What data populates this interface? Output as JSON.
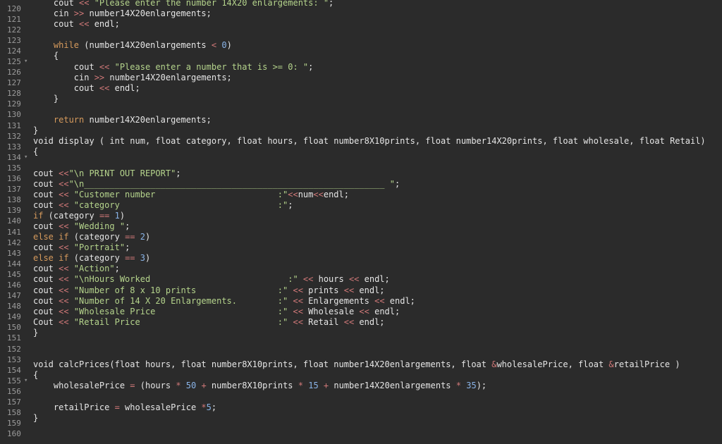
{
  "editor": {
    "lines": [
      {
        "n": "120",
        "fold": "",
        "tokens": [
          {
            "t": "    cout ",
            "c": "txt"
          },
          {
            "t": "<<",
            "c": "op"
          },
          {
            "t": " \"Please enter the number 14X20 enlargements: \"",
            "c": "str"
          },
          {
            "t": ";",
            "c": "txt"
          }
        ]
      },
      {
        "n": "121",
        "fold": "",
        "tokens": [
          {
            "t": "    cin ",
            "c": "txt"
          },
          {
            "t": ">>",
            "c": "op"
          },
          {
            "t": " number14X20enlargements;",
            "c": "txt"
          }
        ]
      },
      {
        "n": "122",
        "fold": "",
        "tokens": [
          {
            "t": "    cout ",
            "c": "txt"
          },
          {
            "t": "<<",
            "c": "op"
          },
          {
            "t": " endl;",
            "c": "txt"
          }
        ]
      },
      {
        "n": "123",
        "fold": "",
        "tokens": []
      },
      {
        "n": "124",
        "fold": "",
        "tokens": [
          {
            "t": "    while",
            "c": "kw"
          },
          {
            "t": " (number14X20enlargements ",
            "c": "txt"
          },
          {
            "t": "<",
            "c": "op"
          },
          {
            "t": " ",
            "c": "txt"
          },
          {
            "t": "0",
            "c": "num"
          },
          {
            "t": ")",
            "c": "txt"
          }
        ]
      },
      {
        "n": "125",
        "fold": "▾",
        "tokens": [
          {
            "t": "    {",
            "c": "txt"
          }
        ]
      },
      {
        "n": "126",
        "fold": "",
        "tokens": [
          {
            "t": "        cout ",
            "c": "txt"
          },
          {
            "t": "<<",
            "c": "op"
          },
          {
            "t": " \"Please enter a number that is >= 0: \"",
            "c": "str"
          },
          {
            "t": ";",
            "c": "txt"
          }
        ]
      },
      {
        "n": "127",
        "fold": "",
        "tokens": [
          {
            "t": "        cin ",
            "c": "txt"
          },
          {
            "t": ">>",
            "c": "op"
          },
          {
            "t": " number14X20enlargements;",
            "c": "txt"
          }
        ]
      },
      {
        "n": "128",
        "fold": "",
        "tokens": [
          {
            "t": "        cout ",
            "c": "txt"
          },
          {
            "t": "<<",
            "c": "op"
          },
          {
            "t": " endl;",
            "c": "txt"
          }
        ]
      },
      {
        "n": "129",
        "fold": "",
        "tokens": [
          {
            "t": "    }",
            "c": "txt"
          }
        ]
      },
      {
        "n": "130",
        "fold": "",
        "tokens": []
      },
      {
        "n": "131",
        "fold": "",
        "tokens": [
          {
            "t": "    return",
            "c": "kw"
          },
          {
            "t": " number14X20enlargements;",
            "c": "txt"
          }
        ]
      },
      {
        "n": "132",
        "fold": "",
        "tokens": [
          {
            "t": "}",
            "c": "txt"
          }
        ]
      },
      {
        "n": "133",
        "fold": "",
        "tokens": [
          {
            "t": "void display ( int num, float category, float hours, float number8X10prints, float number14X20prints, float wholesale, float Retail)",
            "c": "txt"
          }
        ]
      },
      {
        "n": "134",
        "fold": "▾",
        "tokens": [
          {
            "t": "{",
            "c": "txt"
          }
        ]
      },
      {
        "n": "135",
        "fold": "",
        "tokens": []
      },
      {
        "n": "136",
        "fold": "",
        "tokens": [
          {
            "t": "cout ",
            "c": "txt"
          },
          {
            "t": "<<",
            "c": "op"
          },
          {
            "t": "\"\\n PRINT OUT REPORT\"",
            "c": "str"
          },
          {
            "t": ";",
            "c": "txt"
          }
        ]
      },
      {
        "n": "137",
        "fold": "",
        "tokens": [
          {
            "t": "cout ",
            "c": "txt"
          },
          {
            "t": "<<",
            "c": "op"
          },
          {
            "t": "\"\\n___________________________________________________________ \"",
            "c": "str"
          },
          {
            "t": ";",
            "c": "txt"
          }
        ]
      },
      {
        "n": "138",
        "fold": "",
        "tokens": [
          {
            "t": "cout ",
            "c": "txt"
          },
          {
            "t": "<<",
            "c": "op"
          },
          {
            "t": " \"Customer number                        :\"",
            "c": "str"
          },
          {
            "t": "<<",
            "c": "op"
          },
          {
            "t": "num",
            "c": "txt"
          },
          {
            "t": "<<",
            "c": "op"
          },
          {
            "t": "endl;",
            "c": "txt"
          }
        ]
      },
      {
        "n": "139",
        "fold": "",
        "tokens": [
          {
            "t": "cout ",
            "c": "txt"
          },
          {
            "t": "<<",
            "c": "op"
          },
          {
            "t": " \"category                               :\"",
            "c": "str"
          },
          {
            "t": ";",
            "c": "txt"
          }
        ]
      },
      {
        "n": "140",
        "fold": "",
        "tokens": [
          {
            "t": "if",
            "c": "kw"
          },
          {
            "t": " (category ",
            "c": "txt"
          },
          {
            "t": "==",
            "c": "op"
          },
          {
            "t": " ",
            "c": "txt"
          },
          {
            "t": "1",
            "c": "num"
          },
          {
            "t": ")",
            "c": "txt"
          }
        ]
      },
      {
        "n": "141",
        "fold": "",
        "tokens": [
          {
            "t": "cout ",
            "c": "txt"
          },
          {
            "t": "<<",
            "c": "op"
          },
          {
            "t": " \"Wedding \"",
            "c": "str"
          },
          {
            "t": ";",
            "c": "txt"
          }
        ]
      },
      {
        "n": "142",
        "fold": "",
        "tokens": [
          {
            "t": "else if",
            "c": "kw"
          },
          {
            "t": " (category ",
            "c": "txt"
          },
          {
            "t": "==",
            "c": "op"
          },
          {
            "t": " ",
            "c": "txt"
          },
          {
            "t": "2",
            "c": "num"
          },
          {
            "t": ")",
            "c": "txt"
          }
        ]
      },
      {
        "n": "143",
        "fold": "",
        "tokens": [
          {
            "t": "cout ",
            "c": "txt"
          },
          {
            "t": "<<",
            "c": "op"
          },
          {
            "t": " \"Portrait\"",
            "c": "str"
          },
          {
            "t": ";",
            "c": "txt"
          }
        ]
      },
      {
        "n": "144",
        "fold": "",
        "tokens": [
          {
            "t": "else if",
            "c": "kw"
          },
          {
            "t": " (category ",
            "c": "txt"
          },
          {
            "t": "==",
            "c": "op"
          },
          {
            "t": " ",
            "c": "txt"
          },
          {
            "t": "3",
            "c": "num"
          },
          {
            "t": ")",
            "c": "txt"
          }
        ]
      },
      {
        "n": "145",
        "fold": "",
        "tokens": [
          {
            "t": "cout ",
            "c": "txt"
          },
          {
            "t": "<<",
            "c": "op"
          },
          {
            "t": " \"Action\"",
            "c": "str"
          },
          {
            "t": ";",
            "c": "txt"
          }
        ]
      },
      {
        "n": "146",
        "fold": "",
        "tokens": [
          {
            "t": "cout ",
            "c": "txt"
          },
          {
            "t": "<<",
            "c": "op"
          },
          {
            "t": " \"\\nHours Worked                           :\"",
            "c": "str"
          },
          {
            "t": " ",
            "c": "txt"
          },
          {
            "t": "<<",
            "c": "op"
          },
          {
            "t": " hours ",
            "c": "txt"
          },
          {
            "t": "<<",
            "c": "op"
          },
          {
            "t": " endl;",
            "c": "txt"
          }
        ]
      },
      {
        "n": "147",
        "fold": "",
        "tokens": [
          {
            "t": "cout ",
            "c": "txt"
          },
          {
            "t": "<<",
            "c": "op"
          },
          {
            "t": " \"Number of 8 x 10 prints                :\"",
            "c": "str"
          },
          {
            "t": " ",
            "c": "txt"
          },
          {
            "t": "<<",
            "c": "op"
          },
          {
            "t": " prints ",
            "c": "txt"
          },
          {
            "t": "<<",
            "c": "op"
          },
          {
            "t": " endl;",
            "c": "txt"
          }
        ]
      },
      {
        "n": "148",
        "fold": "",
        "tokens": [
          {
            "t": "cout ",
            "c": "txt"
          },
          {
            "t": "<<",
            "c": "op"
          },
          {
            "t": " \"Number of 14 X 20 Enlargements.        :\"",
            "c": "str"
          },
          {
            "t": " ",
            "c": "txt"
          },
          {
            "t": "<<",
            "c": "op"
          },
          {
            "t": " Enlargements ",
            "c": "txt"
          },
          {
            "t": "<<",
            "c": "op"
          },
          {
            "t": " endl;",
            "c": "txt"
          }
        ]
      },
      {
        "n": "149",
        "fold": "",
        "tokens": [
          {
            "t": "cout ",
            "c": "txt"
          },
          {
            "t": "<<",
            "c": "op"
          },
          {
            "t": " \"Wholesale Price                        :\"",
            "c": "str"
          },
          {
            "t": " ",
            "c": "txt"
          },
          {
            "t": "<<",
            "c": "op"
          },
          {
            "t": " Wholesale ",
            "c": "txt"
          },
          {
            "t": "<<",
            "c": "op"
          },
          {
            "t": " endl;",
            "c": "txt"
          }
        ]
      },
      {
        "n": "150",
        "fold": "",
        "tokens": [
          {
            "t": "Cout ",
            "c": "txt"
          },
          {
            "t": "<<",
            "c": "op"
          },
          {
            "t": " \"Retail Price                           :\"",
            "c": "str"
          },
          {
            "t": " ",
            "c": "txt"
          },
          {
            "t": "<<",
            "c": "op"
          },
          {
            "t": " Retail ",
            "c": "txt"
          },
          {
            "t": "<<",
            "c": "op"
          },
          {
            "t": " endl;",
            "c": "txt"
          }
        ]
      },
      {
        "n": "151",
        "fold": "",
        "tokens": [
          {
            "t": "}",
            "c": "txt"
          }
        ]
      },
      {
        "n": "152",
        "fold": "",
        "tokens": []
      },
      {
        "n": "153",
        "fold": "",
        "tokens": []
      },
      {
        "n": "154",
        "fold": "",
        "tokens": [
          {
            "t": "void calcPrices(float hours, float number8X10prints, float number14X20enlargements, float ",
            "c": "txt"
          },
          {
            "t": "&",
            "c": "op"
          },
          {
            "t": "wholesalePrice, float ",
            "c": "txt"
          },
          {
            "t": "&",
            "c": "op"
          },
          {
            "t": "retailPrice )",
            "c": "txt"
          }
        ]
      },
      {
        "n": "155",
        "fold": "▾",
        "tokens": [
          {
            "t": "{",
            "c": "txt"
          }
        ]
      },
      {
        "n": "156",
        "fold": "",
        "tokens": [
          {
            "t": "    wholesalePrice ",
            "c": "txt"
          },
          {
            "t": "=",
            "c": "op"
          },
          {
            "t": " (hours ",
            "c": "txt"
          },
          {
            "t": "*",
            "c": "op"
          },
          {
            "t": " ",
            "c": "txt"
          },
          {
            "t": "50",
            "c": "num"
          },
          {
            "t": " ",
            "c": "txt"
          },
          {
            "t": "+",
            "c": "op"
          },
          {
            "t": " number8X10prints ",
            "c": "txt"
          },
          {
            "t": "*",
            "c": "op"
          },
          {
            "t": " ",
            "c": "txt"
          },
          {
            "t": "15",
            "c": "num"
          },
          {
            "t": " ",
            "c": "txt"
          },
          {
            "t": "+",
            "c": "op"
          },
          {
            "t": " number14X20enlargements ",
            "c": "txt"
          },
          {
            "t": "*",
            "c": "op"
          },
          {
            "t": " ",
            "c": "txt"
          },
          {
            "t": "35",
            "c": "num"
          },
          {
            "t": ");",
            "c": "txt"
          }
        ]
      },
      {
        "n": "157",
        "fold": "",
        "tokens": []
      },
      {
        "n": "158",
        "fold": "",
        "tokens": [
          {
            "t": "    retailPrice ",
            "c": "txt"
          },
          {
            "t": "=",
            "c": "op"
          },
          {
            "t": " wholesalePrice ",
            "c": "txt"
          },
          {
            "t": "*",
            "c": "op"
          },
          {
            "t": "5",
            "c": "num"
          },
          {
            "t": ";",
            "c": "txt"
          }
        ]
      },
      {
        "n": "159",
        "fold": "",
        "tokens": [
          {
            "t": "}",
            "c": "txt"
          }
        ]
      },
      {
        "n": "160",
        "fold": "",
        "tokens": []
      }
    ]
  }
}
